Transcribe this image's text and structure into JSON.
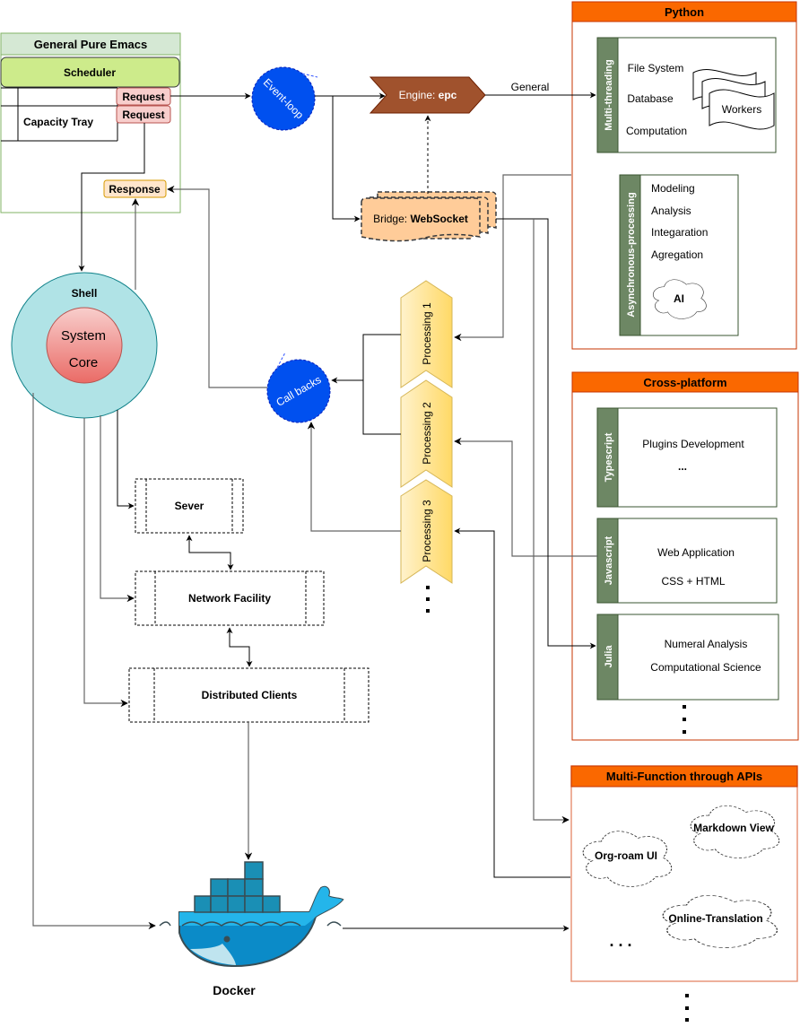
{
  "emacs": {
    "title": "General Pure Emacs",
    "scheduler": "Scheduler",
    "capacity_tray": "Capacity Tray",
    "request_1": "Request",
    "request_2": "Request",
    "response": "Response"
  },
  "event_loop": "Event-loop",
  "engine": {
    "prefix": "Engine: ",
    "name": "epc"
  },
  "bridge": {
    "prefix": "Bridge: ",
    "name": "WebSocket"
  },
  "edge_labels": {
    "general": "General"
  },
  "python": {
    "title": "Python",
    "multithreading": {
      "label": "Multi-threading",
      "items": [
        "File System",
        "Database",
        "Computation"
      ],
      "workers": "Workers"
    },
    "async": {
      "label": "Asynchronous-processing",
      "items": [
        "Modeling",
        "Analysis",
        "Integaration",
        "Agregation"
      ],
      "cloud": "AI"
    }
  },
  "shell": {
    "label": "Shell",
    "core_line1": "System",
    "core_line2": "Core"
  },
  "callbacks": "Call backs",
  "processing": [
    "Processing 1",
    "Processing 2",
    "Processing 3"
  ],
  "network": {
    "server": "Sever",
    "facility": "Network Facility",
    "clients": "Distributed Clients"
  },
  "cross_platform": {
    "title": "Cross-platform",
    "languages": [
      {
        "label": "Typescript",
        "lines": [
          "Plugins Development",
          "..."
        ]
      },
      {
        "label": "Javascript",
        "lines": [
          "Web Application",
          "CSS + HTML"
        ]
      },
      {
        "label": "Julia",
        "lines": [
          "Numeral Analysis",
          "Computational Science"
        ]
      }
    ]
  },
  "multi_function": {
    "title": "Multi-Function through APIs",
    "clouds": [
      "Org-roam UI",
      "Markdown View",
      "Online-Translation"
    ],
    "ellipsis": ". . ."
  },
  "docker": {
    "label": "Docker"
  },
  "colors": {
    "container_header": "#fa6800",
    "container_border": "#c73500",
    "emacs_header": "#d5e8d4",
    "emacs_border": "#82b366",
    "scheduler": "#cdeb8b",
    "request": "#f8cecc",
    "response": "#ffe6cc",
    "engine": "#a0522d",
    "bridge": "#ffcc99",
    "blue_node": "#0050ef",
    "shell": "#b0e3e6",
    "sidebar": "#6d8764"
  }
}
